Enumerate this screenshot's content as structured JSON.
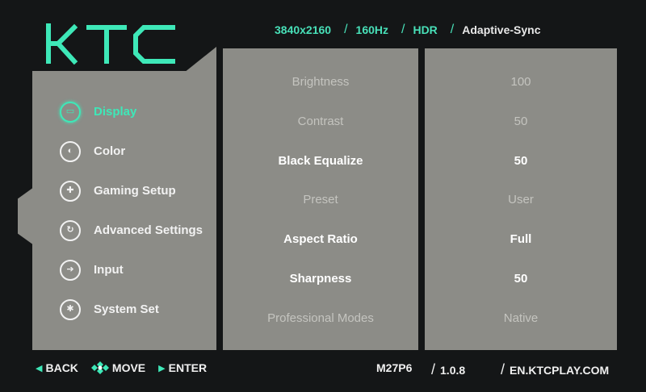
{
  "logo": {
    "text": "KTC"
  },
  "specs": {
    "resolution": "3840x2160",
    "refresh": "160Hz",
    "hdr": "HDR",
    "sync": "Adaptive-Sync"
  },
  "menu": [
    {
      "label": "Display",
      "icon": "display-icon",
      "active": true
    },
    {
      "label": "Color",
      "icon": "color-icon",
      "active": false
    },
    {
      "label": "Gaming Setup",
      "icon": "gamepad-icon",
      "active": false
    },
    {
      "label": "Advanced Settings",
      "icon": "advanced-settings-icon",
      "active": false
    },
    {
      "label": "Input",
      "icon": "input-icon",
      "active": false
    },
    {
      "label": "System Set",
      "icon": "gear-icon",
      "active": false
    }
  ],
  "settings": [
    {
      "label": "Brightness",
      "value": "100",
      "enabled": false
    },
    {
      "label": "Contrast",
      "value": "50",
      "enabled": false
    },
    {
      "label": "Black Equalize",
      "value": "50",
      "enabled": true
    },
    {
      "label": "Preset",
      "value": "User",
      "enabled": false
    },
    {
      "label": "Aspect Ratio",
      "value": "Full",
      "enabled": true
    },
    {
      "label": "Sharpness",
      "value": "50",
      "enabled": true
    },
    {
      "label": "Professional Modes",
      "value": "Native",
      "enabled": false
    }
  ],
  "footer": {
    "back": "BACK",
    "move": "MOVE",
    "enter": "ENTER",
    "model": "M27P6",
    "version": "1.0.8",
    "website": "EN.KTCPLAY.COM"
  },
  "colors": {
    "accent": "#3ee8b8",
    "panel": "#8c8c87",
    "background": "#141617"
  }
}
